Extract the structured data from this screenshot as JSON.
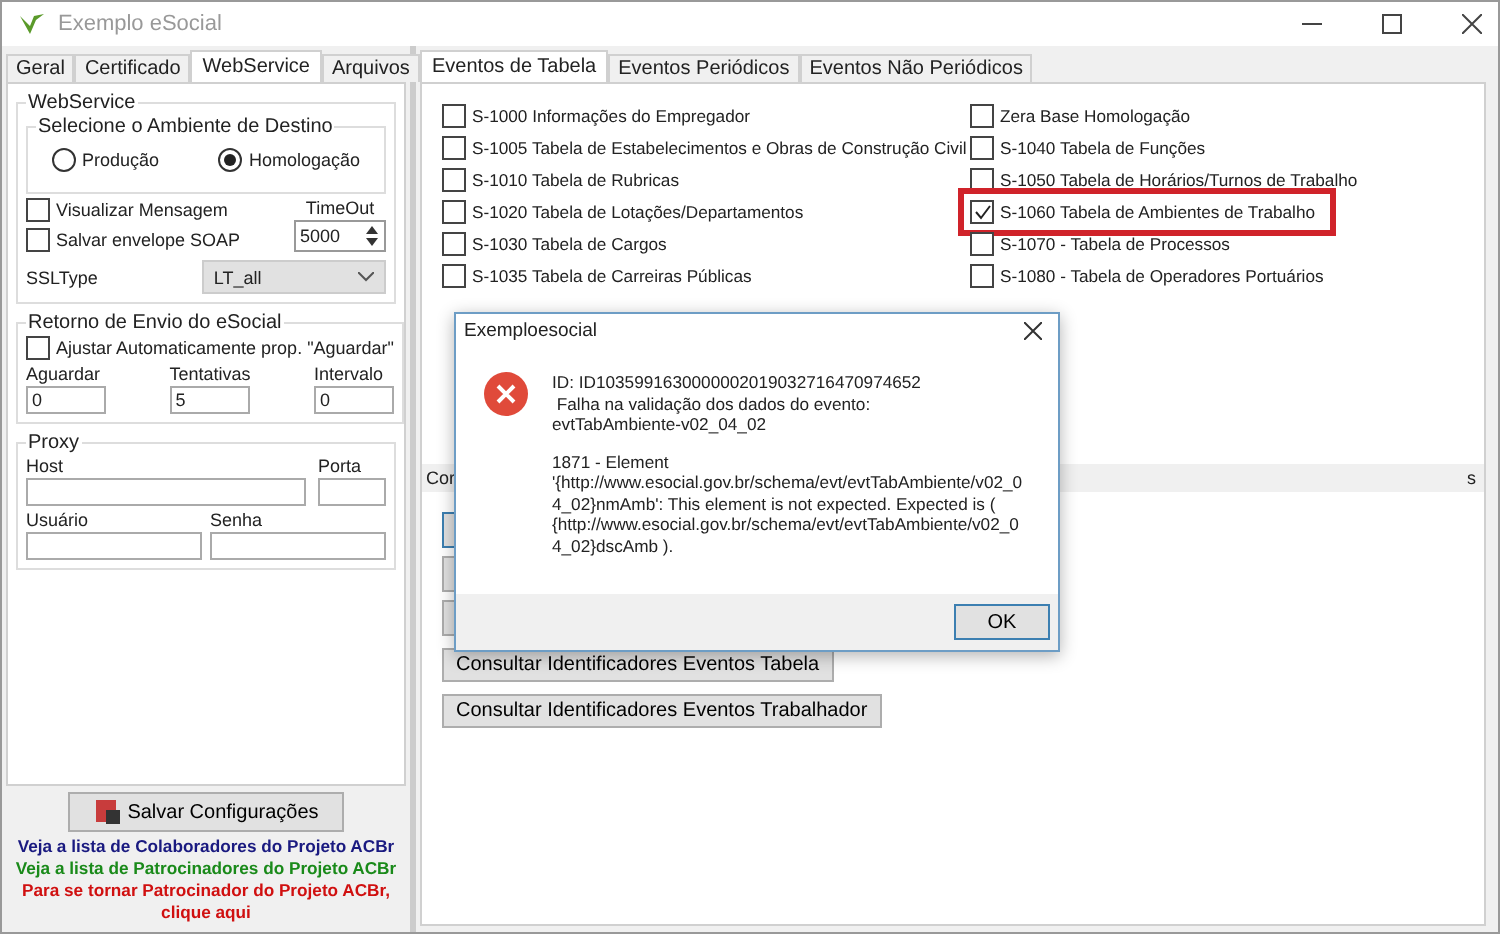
{
  "window": {
    "title": "Exemplo eSocial"
  },
  "left_tabs": [
    {
      "label": "Geral",
      "selected": false
    },
    {
      "label": "Certificado",
      "selected": false
    },
    {
      "label": "WebService",
      "selected": true
    },
    {
      "label": "Arquivos",
      "selected": false
    }
  ],
  "webservice": {
    "title": "WebService",
    "environment_title": "Selecione o Ambiente de Destino",
    "environments": [
      {
        "label": "Produção",
        "selected": false
      },
      {
        "label": "Homologação",
        "selected": true
      }
    ],
    "options": [
      {
        "label": "Visualizar Mensagem",
        "checked": false
      },
      {
        "label": "Salvar envelope SOAP",
        "checked": false
      }
    ],
    "timeout_label": "TimeOut",
    "timeout_value": "5000",
    "ssltype_label": "SSLType",
    "ssltype_value": "LT_all"
  },
  "retorno": {
    "title": "Retorno de Envio do eSocial",
    "auto": {
      "label": "Ajustar Automaticamente prop. \"Aguardar\"",
      "checked": false
    },
    "fields": [
      {
        "label": "Aguardar",
        "value": "0"
      },
      {
        "label": "Tentativas",
        "value": "5"
      },
      {
        "label": "Intervalo",
        "value": "0"
      }
    ]
  },
  "proxy": {
    "title": "Proxy",
    "host_label": "Host",
    "porta_label": "Porta",
    "usuario_label": "Usuário",
    "senha_label": "Senha"
  },
  "save_button": "Salvar Configurações",
  "links": [
    {
      "text": "Veja a lista de Colaboradores do Projeto ACBr",
      "color": "#1a1a80"
    },
    {
      "text": "Veja a lista de Patrocinadores do Projeto ACBr",
      "color": "#1a8a1a"
    },
    {
      "text": "Para se tornar Patrocinador do Projeto ACBr, clique aqui",
      "color": "#d01010"
    }
  ],
  "right_tabs": [
    {
      "label": "Eventos de Tabela",
      "selected": true
    },
    {
      "label": "Eventos Periódicos",
      "selected": false
    },
    {
      "label": "Eventos Não Periódicos",
      "selected": false
    }
  ],
  "events_left": [
    {
      "label": "S-1000 Informações do Empregador",
      "checked": false
    },
    {
      "label": "S-1005 Tabela de Estabelecimentos e Obras de Construção Civil",
      "checked": false
    },
    {
      "label": "S-1010 Tabela de Rubricas",
      "checked": false
    },
    {
      "label": "S-1020 Tabela de Lotações/Departamentos",
      "checked": false
    },
    {
      "label": "S-1030 Tabela de Cargos",
      "checked": false
    },
    {
      "label": "S-1035 Tabela de Carreiras Públicas",
      "checked": false
    }
  ],
  "events_right": [
    {
      "label": "Zera Base Homologação",
      "checked": false,
      "highlighted": false
    },
    {
      "label": "S-1040 Tabela de Funções",
      "checked": false,
      "highlighted": false
    },
    {
      "label": "S-1050 Tabela de Horários/Turnos de Trabalho",
      "checked": false,
      "highlighted": false
    },
    {
      "label": "S-1060 Tabela de Ambientes de Trabalho",
      "checked": true,
      "highlighted": true
    },
    {
      "label": "S-1070 - Tabela de Processos",
      "checked": false,
      "highlighted": false
    },
    {
      "label": "S-1080 - Tabela de Operadores Portuários",
      "checked": false,
      "highlighted": false
    }
  ],
  "lower_tabs": [
    "Cor",
    "s"
  ],
  "lower_buttons": [
    "Consultar Identificadores Eventos Tabela",
    "Consultar Identificadores Eventos Trabalhador"
  ],
  "dialog": {
    "title": "Exemploesocial",
    "paragraphs": [
      "ID: ID1035991630000002019032716470974652\n Falha na validação dos dados do evento:\nevtTabAmbiente-v02_04_02",
      "1871 - Element\n'{http://www.esocial.gov.br/schema/evt/evtTabAmbiente/v02_0\n4_02}nmAmb': This element is not expected. Expected is (\n{http://www.esocial.gov.br/schema/evt/evtTabAmbiente/v02_0\n4_02}dscAmb )."
    ],
    "ok": "OK"
  }
}
